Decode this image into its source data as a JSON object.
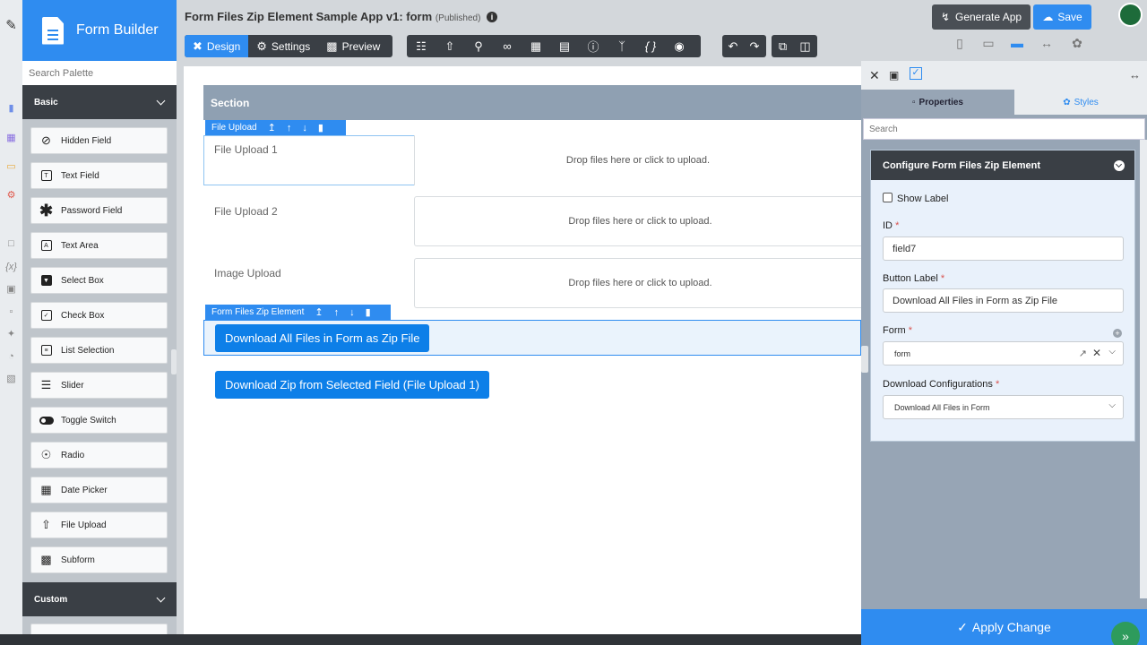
{
  "brand": {
    "title": "Form Builder"
  },
  "palette": {
    "search_placeholder": "Search Palette",
    "basic_label": "Basic",
    "custom_label": "Custom",
    "items": [
      {
        "label": "Hidden Field",
        "icon": "eye-slash-icon"
      },
      {
        "label": "Text Field",
        "icon": "text-field-icon"
      },
      {
        "label": "Password Field",
        "icon": "asterisk-icon"
      },
      {
        "label": "Text Area",
        "icon": "text-area-icon"
      },
      {
        "label": "Select Box",
        "icon": "select-box-icon"
      },
      {
        "label": "Check Box",
        "icon": "checkbox-icon"
      },
      {
        "label": "List Selection",
        "icon": "list-icon"
      },
      {
        "label": "Slider",
        "icon": "slider-icon"
      },
      {
        "label": "Toggle Switch",
        "icon": "toggle-icon"
      },
      {
        "label": "Radio",
        "icon": "radio-icon"
      },
      {
        "label": "Date Picker",
        "icon": "calendar-icon"
      },
      {
        "label": "File Upload",
        "icon": "upload-icon"
      },
      {
        "label": "Subform",
        "icon": "subform-icon"
      }
    ]
  },
  "header": {
    "title": "Form Files Zip Element Sample App v1: form",
    "status": "(Published)",
    "generate_label": "Generate App",
    "save_label": "Save",
    "tabs": {
      "design": "Design",
      "settings": "Settings",
      "preview": "Preview"
    }
  },
  "canvas": {
    "section_title": "Section",
    "file_upload_tag": "File Upload",
    "zip_tag": "Form Files Zip Element",
    "fields": [
      {
        "label": "File Upload 1",
        "drop_text": "Drop files here or click to upload."
      },
      {
        "label": "File Upload 2",
        "drop_text": "Drop files here or click to upload."
      },
      {
        "label": "Image Upload",
        "drop_text": "Drop files here or click to upload."
      }
    ],
    "btn_all": "Download All Files in Form as Zip File",
    "btn_selected": "Download Zip from Selected Field (File Upload 1)"
  },
  "properties": {
    "tab_properties": "Properties",
    "tab_styles": "Styles",
    "search_placeholder": "Search",
    "config_title": "Configure Form Files Zip Element",
    "show_label": "Show Label",
    "id_label": "ID",
    "id_value": "field7",
    "button_label_label": "Button Label",
    "button_label_value": "Download All Files in Form as Zip File",
    "form_label": "Form",
    "form_value": "form",
    "download_config_label": "Download Configurations",
    "download_config_value": "Download All Files in Form",
    "required_mark": "*",
    "apply_label": "Apply Change"
  }
}
